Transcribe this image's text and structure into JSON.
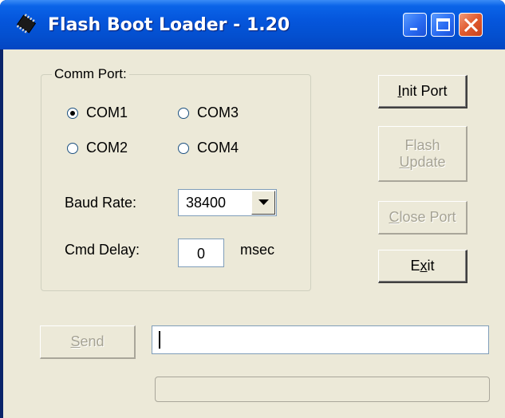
{
  "window": {
    "title": "Flash Boot Loader - 1.20",
    "icon": "chip-icon"
  },
  "comm_port": {
    "label": "Comm Port:",
    "options": [
      {
        "label": "COM1",
        "selected": true
      },
      {
        "label": "COM3",
        "selected": false
      },
      {
        "label": "COM2",
        "selected": false
      },
      {
        "label": "COM4",
        "selected": false
      }
    ],
    "baud_rate_label": "Baud Rate:",
    "baud_rate_value": "38400",
    "cmd_delay_label": "Cmd Delay:",
    "cmd_delay_value": "0",
    "cmd_delay_unit": "msec"
  },
  "buttons": {
    "init_port": {
      "prefix": "",
      "mnemonic": "I",
      "suffix": "nit Port",
      "enabled": true
    },
    "flash_update_line1": "Flash",
    "flash_update_line2": {
      "prefix": "",
      "mnemonic": "U",
      "suffix": "pdate"
    },
    "flash_update_enabled": false,
    "close_port": {
      "prefix": "",
      "mnemonic": "C",
      "suffix": "lose Port",
      "enabled": false
    },
    "exit": {
      "prefix": "E",
      "mnemonic": "x",
      "suffix": "it",
      "enabled": true
    },
    "send": {
      "prefix": "",
      "mnemonic": "S",
      "suffix": "end",
      "enabled": false
    }
  },
  "send_input_value": "",
  "progress_fraction": 0,
  "colors": {
    "titlebar": "#0450d0",
    "client_bg": "#ece9d8",
    "close_button": "#e05a2e"
  }
}
